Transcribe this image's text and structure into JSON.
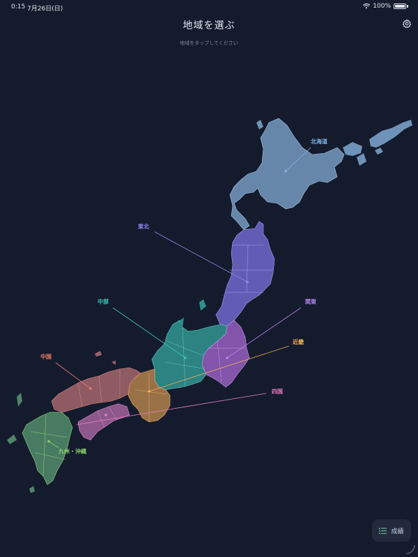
{
  "status_bar": {
    "time": "0:15",
    "date": "7月26日(日)",
    "battery": "100%"
  },
  "header": {
    "title": "地域を選ぶ",
    "subtitle": "地域をタップしてください",
    "settings_icon": "gear-icon"
  },
  "regions": [
    {
      "id": "hokkaido",
      "label": "北海道",
      "color": "#7fb6e6"
    },
    {
      "id": "tohoku",
      "label": "東北",
      "color": "#8c8cf0"
    },
    {
      "id": "chubu",
      "label": "中部",
      "color": "#3fc9b8"
    },
    {
      "id": "kanto",
      "label": "関東",
      "color": "#b784f0"
    },
    {
      "id": "kinki",
      "label": "近畿",
      "color": "#f2b053"
    },
    {
      "id": "chugoku",
      "label": "中国",
      "color": "#f07c6c"
    },
    {
      "id": "shikoku",
      "label": "四国",
      "color": "#ee7fc4"
    },
    {
      "id": "kyushu",
      "label": "九州・沖縄",
      "color": "#8cd36e"
    }
  ],
  "results_button": {
    "label": "成績",
    "icon": "list-icon"
  }
}
